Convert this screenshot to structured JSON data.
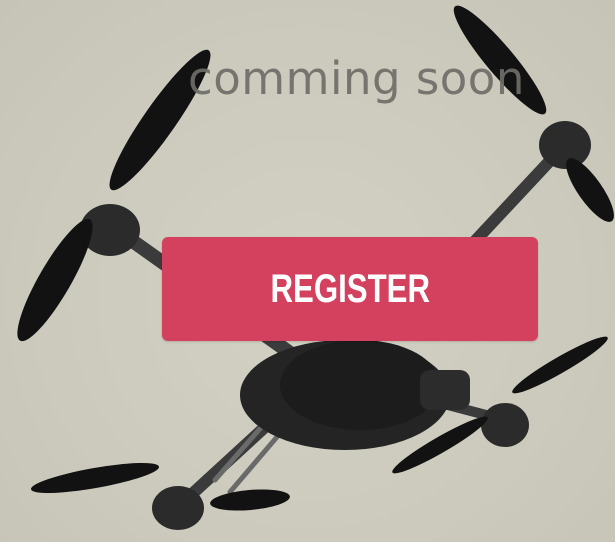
{
  "page": {
    "background_color": "#cfcdbf"
  },
  "hero": {
    "image": "quadcopter-drone-photo",
    "coming_soon_text": "comming soon"
  },
  "cta": {
    "register_label": "REGISTER",
    "button_color": "#d3415f"
  }
}
